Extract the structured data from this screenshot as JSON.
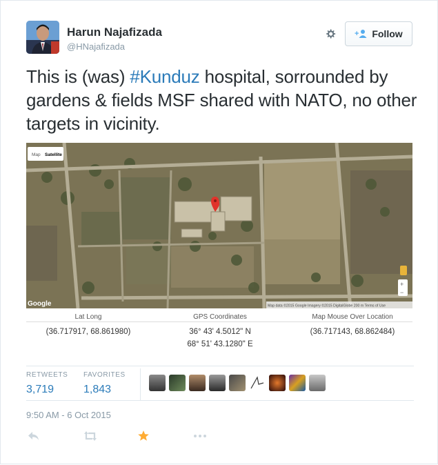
{
  "user": {
    "full_name": "Harun Najafizada",
    "handle": "@HNajafizada"
  },
  "follow_button": {
    "label": "Follow"
  },
  "tweet": {
    "text_before": "This is (was) ",
    "hashtag": "#Kunduz",
    "text_after": " hospital, sorrounded by gardens & fields MSF shared with NATO, no other targets in vicinity."
  },
  "map": {
    "tab_map": "Map",
    "tab_satellite": "Satellite",
    "logo": "Google",
    "footer": "Map data ©2015 Google Imagery ©2015 DigitalGlobe   200 m   Terms of Use",
    "zoom_in": "+",
    "zoom_out": "−"
  },
  "coordinates": {
    "lat_long_label": "Lat Long",
    "lat_long_value": "(36.717917, 68.861980)",
    "gps_label": "GPS Coordinates",
    "gps_line1": "36° 43' 4.5012\" N",
    "gps_line2": "68° 51' 43.1280\" E",
    "mouse_label": "Map Mouse Over Location",
    "mouse_value": "(36.717143, 68.862484)"
  },
  "stats": {
    "retweets_label": "RETWEETS",
    "retweets_count": "3,719",
    "favorites_label": "FAVORITES",
    "favorites_count": "1,843"
  },
  "timestamp": "9:50 AM - 6 Oct 2015",
  "colors": {
    "link": "#2b7bb9",
    "muted": "#8899a6",
    "favorite_star": "#ffac33",
    "action_icon": "#ccd6dd"
  },
  "icons": [
    "gear-icon",
    "follow-person-icon",
    "reply-icon",
    "retweet-icon",
    "favorite-star-icon",
    "more-icon",
    "map-pin-icon"
  ]
}
